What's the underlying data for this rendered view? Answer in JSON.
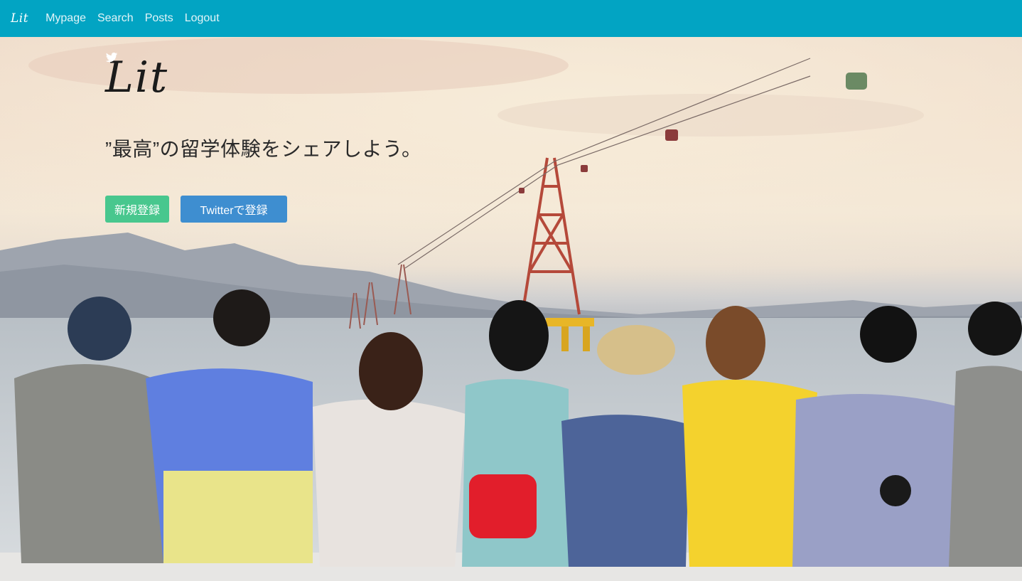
{
  "navbar": {
    "brand": "Lit",
    "links": [
      "Mypage",
      "Search",
      "Posts",
      "Logout"
    ]
  },
  "hero": {
    "logo": "Lit",
    "tagline": "”最高”の留学体験をシェアしよう。",
    "buttons": {
      "register": "新規登録",
      "twitter": "Twitterで登録"
    },
    "background_image": "group-of-friends-sitting-by-sea-with-cable-car-icon"
  },
  "colors": {
    "navbar_bg": "#02a4c3",
    "register_button": "#48c78e",
    "twitter_button": "#3e8ed0"
  }
}
